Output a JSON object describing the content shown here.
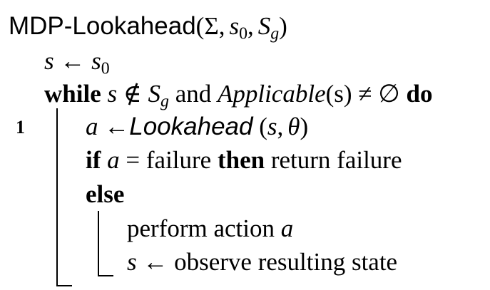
{
  "header": {
    "name": "MDP-Lookahead",
    "open": "(",
    "sigma": "Σ",
    "comma1": ",",
    "s": "s",
    "sub0": "0",
    "comma2": ",",
    "S": "S",
    "subg": "g",
    "close": ")"
  },
  "line_number": "1",
  "init": {
    "s": "s",
    "arrow": "←",
    "s0": "s",
    "sub0": "0"
  },
  "while": {
    "kw": "while",
    "s": "s",
    "notin": "∉",
    "S": "S",
    "subg": "g",
    "and": "and",
    "applicable": "Applicable",
    "args": "(s)",
    "neq": "≠",
    "empty": "∅",
    "do": "do"
  },
  "assign": {
    "a": "a",
    "arrow": "←",
    "lookahead": "Lookahead",
    "args_open": "(",
    "s": "s",
    "comma": ",",
    "theta": "θ",
    "args_close": ")"
  },
  "if_line": {
    "kw_if": "if",
    "a": "a",
    "eq": "=",
    "failure": "failure",
    "kw_then": "then",
    "ret": "return failure"
  },
  "else_line": {
    "kw": "else"
  },
  "perform": {
    "text": "perform action",
    "a": "a"
  },
  "observe": {
    "s": "s",
    "arrow": "←",
    "text": "observe resulting state"
  }
}
